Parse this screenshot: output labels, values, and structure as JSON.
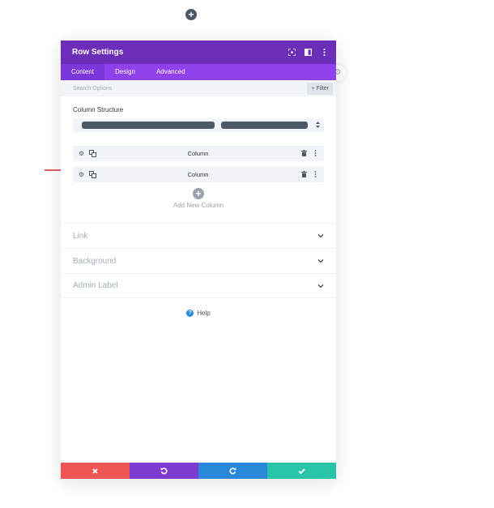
{
  "modal": {
    "title": "Row Settings",
    "tabs": [
      {
        "label": "Content",
        "active": true
      },
      {
        "label": "Design",
        "active": false
      },
      {
        "label": "Advanced",
        "active": false
      }
    ],
    "search_placeholder": "Search Options",
    "filter_label": "+ Filter"
  },
  "content": {
    "column_structure_label": "Column Structure",
    "columns": [
      {
        "label": "Column"
      },
      {
        "label": "Column"
      }
    ],
    "add_column_label": "Add New Column"
  },
  "accordion": [
    {
      "label": "Link"
    },
    {
      "label": "Background"
    },
    {
      "label": "Admin Label"
    }
  ],
  "help_label": "Help",
  "colors": {
    "header": "#6c2eb9",
    "tabs": "#8f42ec",
    "cancel": "#ef5555",
    "undo": "#7e3bd0",
    "redo": "#2b87da",
    "save": "#29c4a9",
    "arrow": "#d9262c"
  },
  "icons": {
    "top": "plus-icon",
    "header": [
      "expand-icon",
      "sidebar-layout-icon",
      "more-vertical-icon"
    ],
    "footer": [
      "close-icon",
      "undo-icon",
      "redo-icon",
      "check-icon"
    ]
  }
}
